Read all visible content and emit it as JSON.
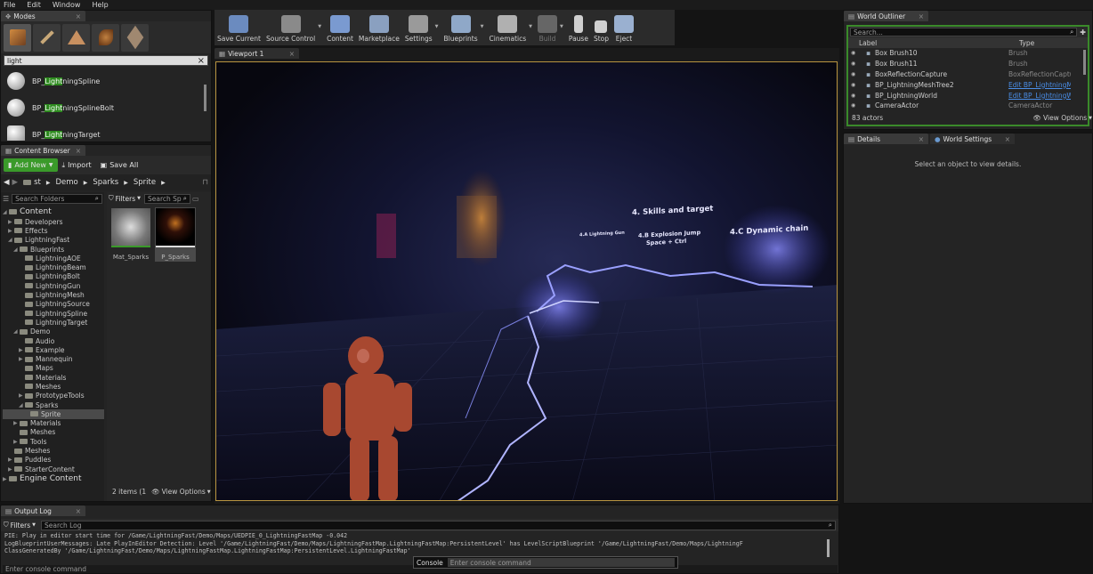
{
  "menu": [
    "File",
    "Edit",
    "Window",
    "Help"
  ],
  "modes": {
    "tab": "Modes",
    "search_value": "light",
    "results": [
      {
        "pre": "BP_",
        "hl": "Light",
        "post": "ningSpline"
      },
      {
        "pre": "BP_",
        "hl": "Light",
        "post": "ningSplineBolt"
      },
      {
        "pre": "BP_",
        "hl": "Light",
        "post": "ningTarget"
      }
    ]
  },
  "content_browser": {
    "tab": "Content Browser",
    "add_new": "Add New",
    "import": "Import",
    "save_all": "Save All",
    "path": [
      "st",
      "Demo",
      "Sparks",
      "Sprite"
    ],
    "search_folders_placeholder": "Search Folders",
    "filters": "Filters",
    "search_placeholder": "Search Sp",
    "tree": [
      {
        "label": "Content",
        "depth": 0,
        "big": true,
        "exp": "◢"
      },
      {
        "label": "Developers",
        "depth": 1,
        "exp": "▶"
      },
      {
        "label": "Effects",
        "depth": 1,
        "exp": "▶"
      },
      {
        "label": "LightningFast",
        "depth": 1,
        "exp": "◢"
      },
      {
        "label": "Blueprints",
        "depth": 2,
        "exp": "◢"
      },
      {
        "label": "LightningAOE",
        "depth": 3,
        "exp": ""
      },
      {
        "label": "LightningBeam",
        "depth": 3,
        "exp": ""
      },
      {
        "label": "LightningBolt",
        "depth": 3,
        "exp": ""
      },
      {
        "label": "LightningGun",
        "depth": 3,
        "exp": ""
      },
      {
        "label": "LightningMesh",
        "depth": 3,
        "exp": ""
      },
      {
        "label": "LightningSource",
        "depth": 3,
        "exp": ""
      },
      {
        "label": "LightningSpline",
        "depth": 3,
        "exp": ""
      },
      {
        "label": "LightningTarget",
        "depth": 3,
        "exp": ""
      },
      {
        "label": "Demo",
        "depth": 2,
        "exp": "◢"
      },
      {
        "label": "Audio",
        "depth": 3,
        "exp": ""
      },
      {
        "label": "Example",
        "depth": 3,
        "exp": "▶"
      },
      {
        "label": "Mannequin",
        "depth": 3,
        "exp": "▶"
      },
      {
        "label": "Maps",
        "depth": 3,
        "exp": ""
      },
      {
        "label": "Materials",
        "depth": 3,
        "exp": ""
      },
      {
        "label": "Meshes",
        "depth": 3,
        "exp": ""
      },
      {
        "label": "PrototypeTools",
        "depth": 3,
        "exp": "▶"
      },
      {
        "label": "Sparks",
        "depth": 3,
        "exp": "◢"
      },
      {
        "label": "Sprite",
        "depth": 4,
        "exp": "",
        "selected": true
      },
      {
        "label": "Materials",
        "depth": 2,
        "exp": "▶"
      },
      {
        "label": "Meshes",
        "depth": 2,
        "exp": ""
      },
      {
        "label": "Tools",
        "depth": 2,
        "exp": "▶"
      },
      {
        "label": "Meshes",
        "depth": 1,
        "exp": ""
      },
      {
        "label": "Puddles",
        "depth": 1,
        "exp": "▶"
      },
      {
        "label": "StarterContent",
        "depth": 1,
        "exp": "▶"
      },
      {
        "label": "Engine Content",
        "depth": 0,
        "big": true,
        "exp": "▶"
      }
    ],
    "assets": [
      {
        "label": "Mat_Sparks"
      },
      {
        "label": "P_Sparks"
      }
    ],
    "item_count": "2 items (1",
    "view_options": "View Options"
  },
  "toolbar": [
    {
      "label": "Save Current",
      "icon": "save-icon",
      "color": "#6b8bbf"
    },
    {
      "label": "Source Control",
      "icon": "source-control-icon",
      "color": "#8a8a8a"
    },
    {
      "label": "Content",
      "icon": "content-icon",
      "color": "#7a9ad0"
    },
    {
      "label": "Marketplace",
      "icon": "marketplace-icon",
      "color": "#8aa0c0"
    },
    {
      "label": "Settings",
      "icon": "settings-icon",
      "color": "#9a9a9a"
    },
    {
      "label": "Blueprints",
      "icon": "blueprints-icon",
      "color": "#8fa8c8"
    },
    {
      "label": "Cinematics",
      "icon": "cinematics-icon",
      "color": "#b0b0b0"
    },
    {
      "label": "Build",
      "icon": "build-icon",
      "color": "#666666"
    },
    {
      "label": "Pause",
      "icon": "pause-icon",
      "color": "#d0d0d0"
    },
    {
      "label": "Stop",
      "icon": "stop-icon",
      "color": "#d0d0d0"
    },
    {
      "label": "Eject",
      "icon": "eject-icon",
      "color": "#9ab0d0"
    }
  ],
  "viewport": {
    "tab": "Viewport 1",
    "signs": [
      "4. Skills and target",
      "4.C Dynamic chain",
      "4.B Explosion Jump",
      "Space + Ctrl",
      "4.A Lightning Gun"
    ]
  },
  "outliner": {
    "tab": "World Outliner",
    "search_placeholder": "Search...",
    "col_label": "Label",
    "col_type": "Type",
    "rows": [
      {
        "label": "Box Brush10",
        "type": "Brush",
        "link": false
      },
      {
        "label": "Box Brush11",
        "type": "Brush",
        "link": false
      },
      {
        "label": "BoxReflectionCapture",
        "type": "BoxReflectionCapture",
        "link": false
      },
      {
        "label": "BP_LightningMeshTree2",
        "type": "Edit BP_LightningMe",
        "link": true
      },
      {
        "label": "BP_LightningWorld",
        "type": "Edit BP_LightningW",
        "link": true
      },
      {
        "label": "CameraActor",
        "type": "CameraActor",
        "link": false
      }
    ],
    "count": "83 actors",
    "view_options": "View Options"
  },
  "details": {
    "tab": "Details",
    "world_settings_tab": "World Settings",
    "empty": "Select an object to view details."
  },
  "output_log": {
    "tab": "Output Log",
    "filters": "Filters",
    "search_placeholder": "Search Log",
    "lines": [
      "PIE: Play in editor start time for /Game/LightningFast/Demo/Maps/UEDPIE_0_LightningFastMap -0.042",
      "LogBlueprintUserMessages: Late PlayInEditor Detection: Level '/Game/LightningFast/Demo/Maps/LightningFastMap.LightningFastMap:PersistentLevel' has LevelScriptBlueprint '/Game/LightningFast/Demo/Maps/LightningF",
      "ClassGeneratedBy '/Game/LightningFast/Demo/Maps/LightningFastMap.LightningFastMap:PersistentLevel.LightningFastMap'"
    ],
    "console_label": "Console",
    "console_placeholder": "Enter console command",
    "bottom_placeholder": "Enter console command"
  },
  "colors": {
    "accent_green": "#3a9a2a",
    "link": "#4a8ee8",
    "highlight": "#2d8a1e"
  }
}
